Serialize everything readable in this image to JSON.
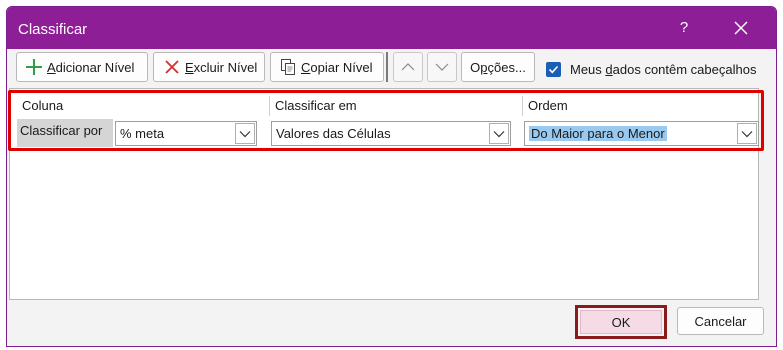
{
  "window": {
    "title": "Classificar",
    "help": "?"
  },
  "toolbar": {
    "add_level": {
      "mnemonic": "A",
      "rest": "dicionar Nível"
    },
    "delete_level": {
      "mnemonic": "E",
      "rest": "xcluir Nível"
    },
    "copy_level": {
      "mnemonic": "C",
      "rest": "opiar Nível"
    },
    "options": {
      "before": "O",
      "mnemonic": "p",
      "rest": "ções..."
    },
    "headers_checkbox": {
      "before": "Meus ",
      "mnemonic": "d",
      "rest": "ados contêm cabeçalhos",
      "checked": true
    }
  },
  "grid": {
    "headers": {
      "column": "Coluna",
      "sort_on": "Classificar em",
      "order": "Ordem"
    },
    "row": {
      "label": "Classificar por",
      "column_value": "% meta",
      "sort_on_value": "Valores das Células",
      "order_value": "Do Maior para o Menor"
    }
  },
  "footer": {
    "ok": "OK",
    "cancel": "Cancelar"
  },
  "icons": {
    "add": "plus-icon",
    "delete": "x-icon",
    "copy": "copy-icon",
    "move_up": "chevron-up-icon",
    "move_down": "chevron-down-icon",
    "dropdown": "chevron-down-icon",
    "close": "close-icon",
    "check": "checkmark-icon"
  },
  "colors": {
    "titlebar": "#8e1e96",
    "highlight_box": "#e00000",
    "ok_highlight": "#8b1a1a",
    "checkbox": "#1b5fb4",
    "selection": "#99c9ef",
    "add_icon": "#2f9e44",
    "delete_icon": "#d22f2f"
  }
}
